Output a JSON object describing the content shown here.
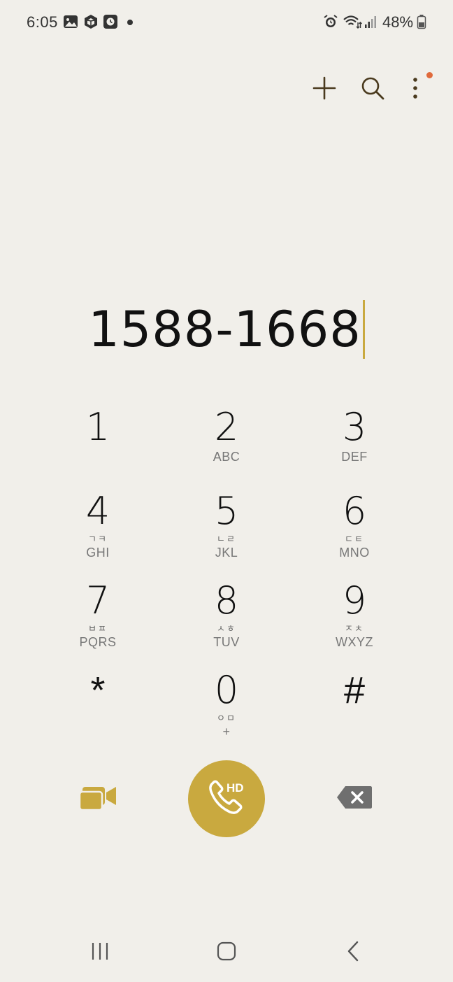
{
  "status_bar": {
    "time": "6:05",
    "battery": "48%",
    "icons": [
      "gallery-icon",
      "cube-app-icon",
      "clock-app-icon",
      "alarm-icon",
      "wifi-icon",
      "signal-icon",
      "battery-icon"
    ]
  },
  "toolbar": {
    "icons": [
      "add-icon",
      "search-icon",
      "more-options-icon"
    ],
    "accent_dot_color": "#e06a3c"
  },
  "dialer": {
    "number": "1588-1668",
    "cursor_color": "#c9a93f"
  },
  "keypad": {
    "keys": [
      {
        "digit": "1",
        "kor": "",
        "letters": ""
      },
      {
        "digit": "2",
        "kor": "",
        "letters": "ABC"
      },
      {
        "digit": "3",
        "kor": "",
        "letters": "DEF"
      },
      {
        "digit": "4",
        "kor": "ㄱㅋ",
        "letters": "GHI"
      },
      {
        "digit": "5",
        "kor": "ㄴㄹ",
        "letters": "JKL"
      },
      {
        "digit": "6",
        "kor": "ㄷㅌ",
        "letters": "MNO"
      },
      {
        "digit": "7",
        "kor": "ㅂㅍ",
        "letters": "PQRS"
      },
      {
        "digit": "8",
        "kor": "ㅅㅎ",
        "letters": "TUV"
      },
      {
        "digit": "9",
        "kor": "ㅈㅊ",
        "letters": "WXYZ"
      },
      {
        "digit": "*",
        "kor": "",
        "letters": ""
      },
      {
        "digit": "0",
        "kor": "ㅇㅁ",
        "letters": "+"
      },
      {
        "digit": "#",
        "kor": "",
        "letters": ""
      }
    ]
  },
  "actions": {
    "call_label": "HD",
    "accent_color": "#c9a93f",
    "icons": [
      "video-call-icon",
      "phone-icon",
      "backspace-icon"
    ]
  },
  "nav": {
    "icons": [
      "recent-apps-icon",
      "home-icon",
      "back-icon"
    ]
  }
}
